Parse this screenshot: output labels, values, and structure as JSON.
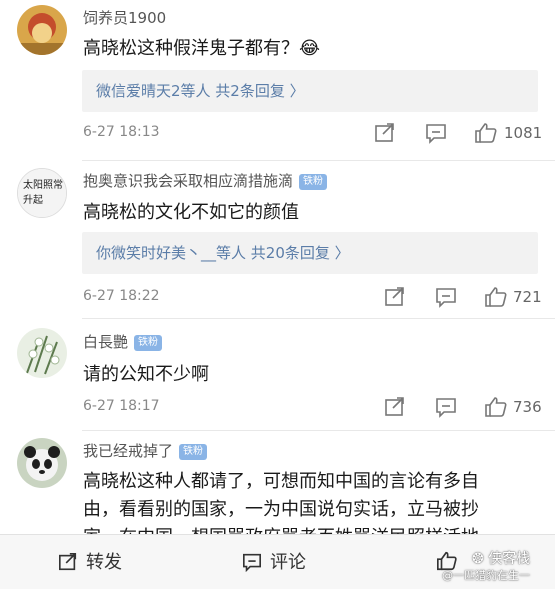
{
  "comments": [
    {
      "username": "饲养员1900",
      "badge": "",
      "text_lines": [
        "高晓松这种假洋鬼子都有？😂"
      ],
      "reply_summary": "微信爱晴天2等人  共2条回复 〉",
      "time": "6-27 18:13",
      "likes": "1081"
    },
    {
      "username": "抱奥意识我会采取相应滴措施滴",
      "badge": "铁粉",
      "avatar_text": "太阳照常升起",
      "text_lines": [
        "高晓松的文化不如它的颜值"
      ],
      "reply_summary": "你微笑时好美丶__等人  共20条回复 〉",
      "time": "6-27 18:22",
      "likes": "721"
    },
    {
      "username": "白長艷",
      "badge": "铁粉",
      "text_lines": [
        "请的公知不少啊"
      ],
      "reply_summary": "",
      "time": "6-27 18:17",
      "likes": "736"
    },
    {
      "username": "我已经戒掉了",
      "badge": "铁粉",
      "text_lines": [
        "高晓松这种人都请了，可想而知中国的言论有多自",
        "由，看看别的国家，一为中国说句实话，立马被抄",
        "家，在中国，想国骂政府骂老百姓骂洋民照样活地"
      ],
      "reply_summary": "",
      "time": "",
      "likes": ""
    }
  ],
  "bottom_bar": {
    "repost_label": "转发",
    "comment_label": "评论"
  },
  "watermark": {
    "line1": "侠客栈",
    "line2": "@一匹猎豹在生一"
  },
  "colors": {
    "link_blue": "#5b7da8",
    "badge_blue": "#8ab4e6",
    "reply_bg": "#f2f2f2"
  }
}
